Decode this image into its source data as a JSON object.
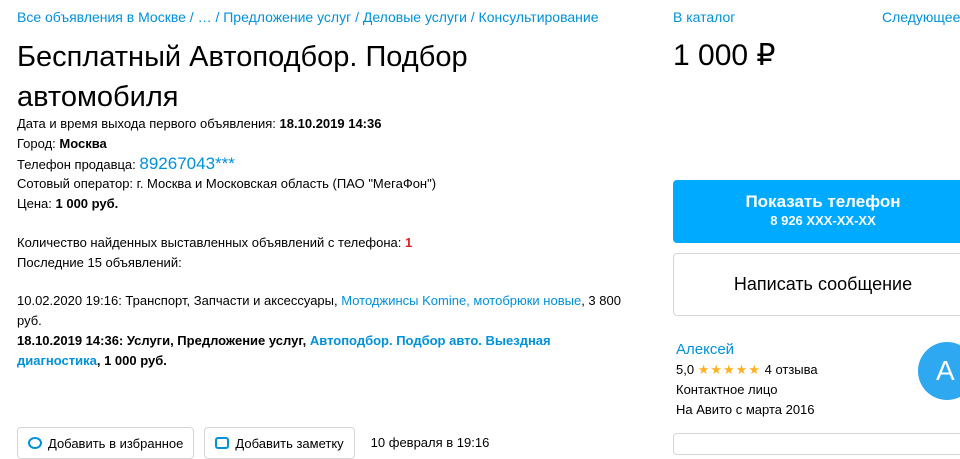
{
  "breadcrumb": {
    "text": "Все объявления в Москве / … / Предложение услуг / Деловые услуги / Консультирование"
  },
  "title": "Бесплатный Автоподбор. Подбор автомобиля",
  "meta": {
    "first_posted_label": "Дата и время выхода первого объявления:",
    "first_posted_value": "18.10.2019 14:36",
    "city_label": "Город:",
    "city_value": "Москва",
    "phone_label": "Телефон продавца:",
    "phone_value": "89267043***",
    "operator_text": "Сотовый оператор: г. Москва и Московская область (ПАО \"МегаФон\")",
    "price_label": "Цена:",
    "price_value": "1 000 руб.",
    "count_label": "Количество найденных выставленных объявлений с телефона:",
    "count_value": "1",
    "last_label": "Последние 15 объявлений:"
  },
  "history": [
    {
      "prefix": "10.02.2020 19:16: Транспорт, Запчасти и аксессуары,",
      "link": "Мотоджинсы Komine, мотобрюки новые",
      "suffix": ", 3 800 руб.",
      "bold": false
    },
    {
      "prefix": "18.10.2019 14:36: Услуги, Предложение услуг,",
      "link": "Автоподбор. Подбор авто. Выездная диагностика",
      "suffix": ", 1 000 руб.",
      "bold": true
    }
  ],
  "bottom": {
    "fav_label": "Добавить в избранное",
    "note_label": "Добавить заметку",
    "date": "10 февраля в 19:16"
  },
  "right": {
    "catalog_link": "В каталог",
    "next_link": "Следующее",
    "price": "1 000 ₽",
    "show_phone_label": "Показать телефон",
    "show_phone_number": "8 926 XXX-XX-XX",
    "write_label": "Написать сообщение"
  },
  "seller": {
    "name": "Алексей",
    "rating": "5,0",
    "stars": "★★★★★",
    "reviews": "4 отзыва",
    "type": "Контактное лицо",
    "since": "На Авито с марта 2016",
    "avatar_letter": "А"
  },
  "colors": {
    "link": "#0091d9",
    "primary_button": "#00aaff",
    "star": "#ffb021",
    "count_red": "#e02020"
  }
}
